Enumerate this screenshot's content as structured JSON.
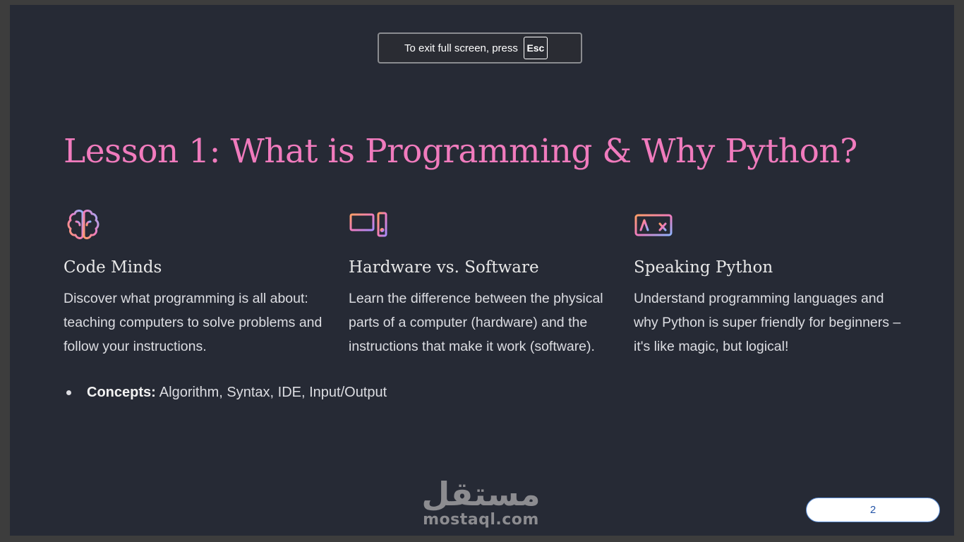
{
  "fullscreen_notice": {
    "text": "To exit full screen, press",
    "key": "Esc"
  },
  "slide": {
    "title": "Lesson 1: What is Programming & Why Python?",
    "columns": [
      {
        "icon": "brain-icon",
        "heading": "Code Minds",
        "text": "Discover what programming is all about: teaching computers to solve problems and follow your instructions."
      },
      {
        "icon": "computer-icon",
        "heading": "Hardware vs. Software",
        "text": "Learn the difference between the physical parts of a computer (hardware) and the instructions that make it work (software)."
      },
      {
        "icon": "translate-icon",
        "heading": "Speaking Python",
        "text": "Understand programming languages and why Python is super friendly for beginners – it's like magic, but logical!"
      }
    ],
    "bullet": {
      "label": "Concepts:",
      "text": "Algorithm, Syntax, IDE, Input/Output"
    }
  },
  "watermark": {
    "arabic": "مستقل",
    "latin": "mostaql.com"
  },
  "page_indicator": {
    "page": "2"
  },
  "colors": {
    "title": "#f07bbd",
    "background": "#262a35",
    "icon_gradient_start": "#ff9f68",
    "icon_gradient_end": "#a78bfa"
  }
}
